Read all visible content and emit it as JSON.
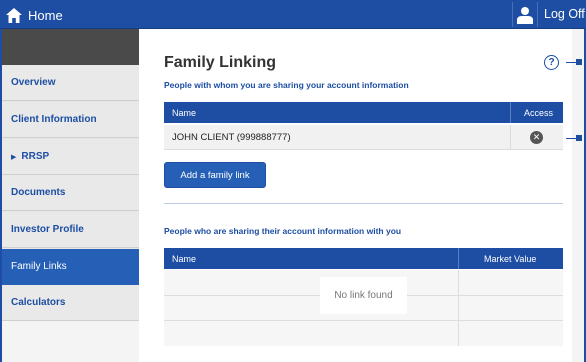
{
  "topbar": {
    "home_label": "Home",
    "logoff_label": "Log Off"
  },
  "sidebar": {
    "items": [
      {
        "label": "Overview"
      },
      {
        "label": "Client Information"
      },
      {
        "label": "RRSP",
        "expandable": true
      },
      {
        "label": "Documents"
      },
      {
        "label": "Investor Profile"
      },
      {
        "label": "Family Links",
        "active": true
      },
      {
        "label": "Calculators"
      }
    ]
  },
  "main": {
    "title": "Family Linking",
    "sharing_out": {
      "label": "People with whom you are sharing your account information",
      "columns": [
        "Name",
        "Access"
      ],
      "rows": [
        {
          "name": "JOHN CLIENT (999888777)"
        }
      ]
    },
    "add_button_label": "Add a family link",
    "sharing_in": {
      "label": "People who are sharing their account information with you",
      "columns": [
        "Name",
        "Market Value"
      ],
      "empty_message": "No link found"
    }
  },
  "colors": {
    "brand": "#1d4ea3",
    "active_nav": "#2660b6"
  },
  "icons": [
    "home-icon",
    "user-icon",
    "help-icon",
    "remove-icon",
    "caret-right-icon"
  ]
}
